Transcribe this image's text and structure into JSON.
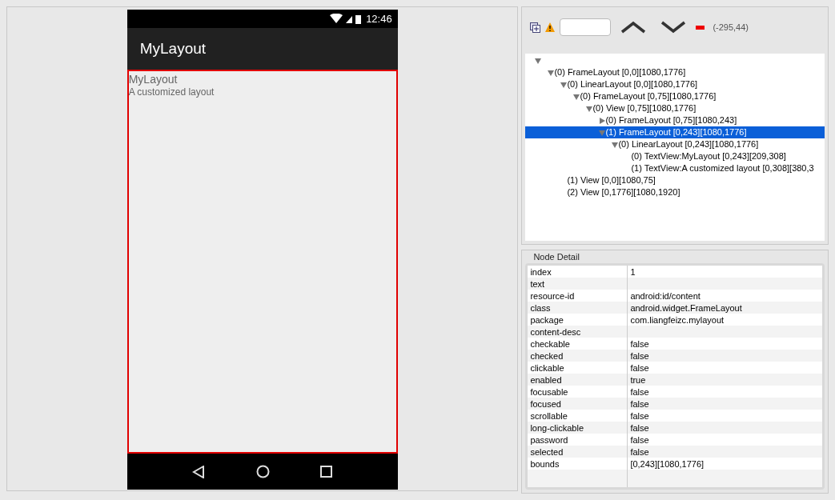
{
  "device": {
    "status_bar": {
      "time": "12:46"
    },
    "action_bar": {
      "title": "MyLayout"
    },
    "content": {
      "texts": [
        "MyLayout",
        "A customized layout"
      ],
      "highlighted": true
    }
  },
  "toolbar": {
    "coordinates": "(-295,44)"
  },
  "tree": {
    "expanded": true,
    "selected": false,
    "children": [
      {
        "label": "(0) FrameLayout [0,0][1080,1776]",
        "expanded": true,
        "selected": false,
        "children": [
          {
            "label": "(0) LinearLayout [0,0][1080,1776]",
            "expanded": true,
            "selected": false,
            "children": [
              {
                "label": "(0) FrameLayout [0,75][1080,1776]",
                "expanded": true,
                "selected": false,
                "children": [
                  {
                    "label": "(0) View [0,75][1080,1776]",
                    "expanded": true,
                    "selected": false,
                    "children": [
                      {
                        "label": "(0) FrameLayout [0,75][1080,243]",
                        "expanded": false,
                        "selected": false
                      },
                      {
                        "label": "(1) FrameLayout [0,243][1080,1776]",
                        "expanded": true,
                        "selected": true,
                        "children": [
                          {
                            "label": "(0) LinearLayout [0,243][1080,1776]",
                            "expanded": true,
                            "selected": false,
                            "children": [
                              {
                                "label": "(0) TextView:MyLayout [0,243][209,308]",
                                "selected": false
                              },
                              {
                                "label": "(1) TextView:A customized layout [0,308][380,3",
                                "selected": false
                              }
                            ]
                          }
                        ]
                      }
                    ]
                  }
                ]
              }
            ]
          },
          {
            "label": "(1) View [0,0][1080,75]",
            "selected": false
          },
          {
            "label": "(2) View [0,1776][1080,1920]",
            "selected": false
          }
        ]
      }
    ]
  },
  "node_detail": {
    "title": "Node Detail",
    "rows": [
      {
        "key": "index",
        "value": "1"
      },
      {
        "key": "text"
      },
      {
        "key": "resource-id",
        "value": "android:id/content"
      },
      {
        "key": "class",
        "value": "android.widget.FrameLayout"
      },
      {
        "key": "package",
        "value": "com.liangfeizc.mylayout"
      },
      {
        "key": "content-desc"
      },
      {
        "key": "checkable",
        "value": "false"
      },
      {
        "key": "checked",
        "value": "false"
      },
      {
        "key": "clickable",
        "value": "false"
      },
      {
        "key": "enabled",
        "value": "true"
      },
      {
        "key": "focusable",
        "value": "false"
      },
      {
        "key": "focused",
        "value": "false"
      },
      {
        "key": "scrollable",
        "value": "false"
      },
      {
        "key": "long-clickable",
        "value": "false"
      },
      {
        "key": "password",
        "value": "false"
      },
      {
        "key": "selected",
        "value": "false"
      },
      {
        "key": "bounds",
        "value": "[0,243][1080,1776]"
      }
    ]
  }
}
